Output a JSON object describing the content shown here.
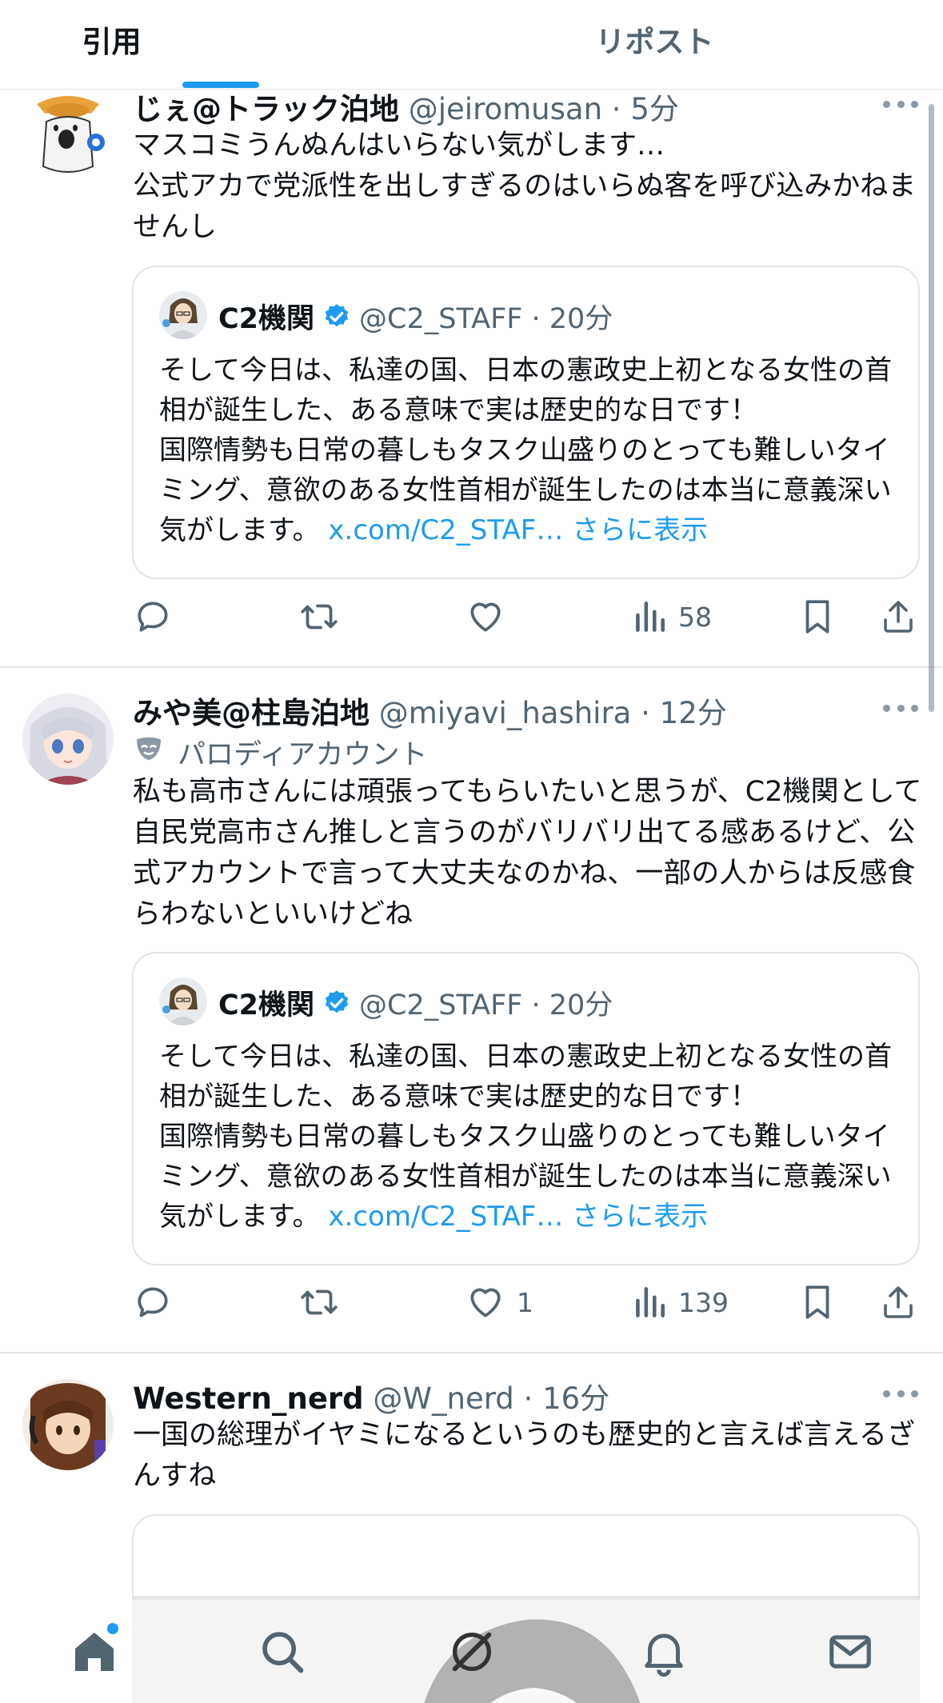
{
  "tabs": {
    "quote": "引用",
    "repost": "リポスト"
  },
  "posts": [
    {
      "name": "じぇ@トラック泊地",
      "handle": "@jeiromusan",
      "dot": "·",
      "time": "5分",
      "text": "マスコミうんぬんはいらない気がします…\n公式アカで党派性を出しすぎるのはいらぬ客を呼び込みかねませんし",
      "quote": {
        "name": "C2機関",
        "handle": "@C2_STAFF · 20分",
        "text": "そして今日は、私達の国、日本の憲政史上初となる女性の首相が誕生した、ある意味で実は歴史的な日です！\n国際情勢も日常の暮しもタスク山盛りのとっても難しいタイミング、意欲のある女性首相が誕生したのは本当に意義深い気がします。",
        "link": "x.com/C2_STAF…",
        "more": "さらに表示"
      },
      "stats": {
        "replies": "",
        "reposts": "",
        "likes": "",
        "views": "58"
      }
    },
    {
      "name": "みや美@柱島泊地",
      "handle": "@miyavi_hashira",
      "dot": "·",
      "time": "12分",
      "parody_label": "パロディアカウント",
      "text": "私も高市さんには頑張ってもらいたいと思うが、C2機関として自民党高市さん推しと言うのがバリバリ出てる感あるけど、公式アカウントで言って大丈夫なのかね、一部の人からは反感食らわないといいけどね",
      "quote": {
        "name": "C2機関",
        "handle": "@C2_STAFF · 20分",
        "text": "そして今日は、私達の国、日本の憲政史上初となる女性の首相が誕生した、ある意味で実は歴史的な日です！\n国際情勢も日常の暮しもタスク山盛りのとっても難しいタイミング、意欲のある女性首相が誕生したのは本当に意義深い気がします。",
        "link": "x.com/C2_STAF…",
        "more": "さらに表示"
      },
      "stats": {
        "replies": "",
        "reposts": "",
        "likes": "1",
        "views": "139"
      }
    },
    {
      "name": "Western_nerd",
      "handle": "@W_nerd",
      "dot": "·",
      "time": "16分",
      "text": "一国の総理がイヤミになるというのも歴史的と言えば言えるざんすね"
    }
  ],
  "colors": {
    "accent": "#1d9bf0",
    "text_primary": "#0f1419",
    "text_secondary": "#536471",
    "divider": "#e1e4e8",
    "verified": "#1d9bf0"
  },
  "icons": [
    "reply-icon",
    "repost-icon",
    "like-icon",
    "views-icon",
    "bookmark-icon",
    "share-icon",
    "more-icon",
    "verified-badge-icon",
    "parody-mask-icon",
    "home-icon",
    "search-icon",
    "grok-icon",
    "notifications-icon",
    "messages-icon"
  ]
}
